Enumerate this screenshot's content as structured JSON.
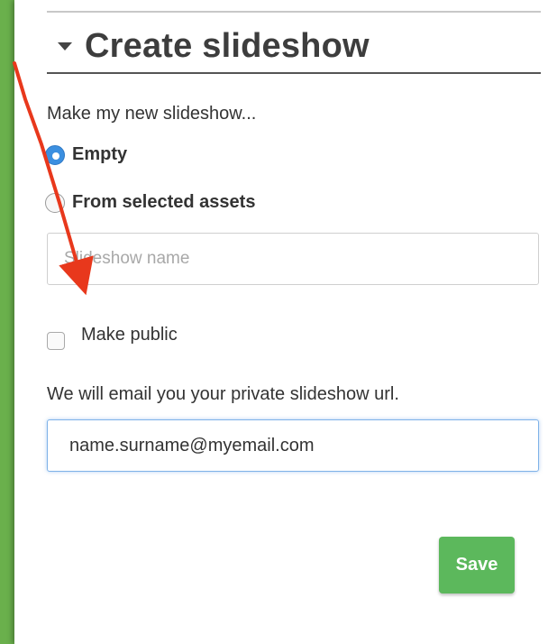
{
  "panel": {
    "title": "Create slideshow",
    "intro": "Make my new slideshow...",
    "options": [
      {
        "label": "Empty",
        "checked": true
      },
      {
        "label": "From selected assets",
        "checked": false
      }
    ],
    "name_placeholder": "Slideshow name",
    "make_public_label": "Make public",
    "make_public_checked": false,
    "email_note": "We will email you your private slideshow url.",
    "email_value": "name.surname@myemail.com",
    "save_label": "Save"
  },
  "colors": {
    "background": "#6ab04c",
    "accent": "#3b8fe0",
    "save": "#5cb85c",
    "annotation_arrow": "#e8381c"
  },
  "icons": {
    "collapse": "caret-down-icon",
    "annotation": "red-arrow-annotation"
  }
}
